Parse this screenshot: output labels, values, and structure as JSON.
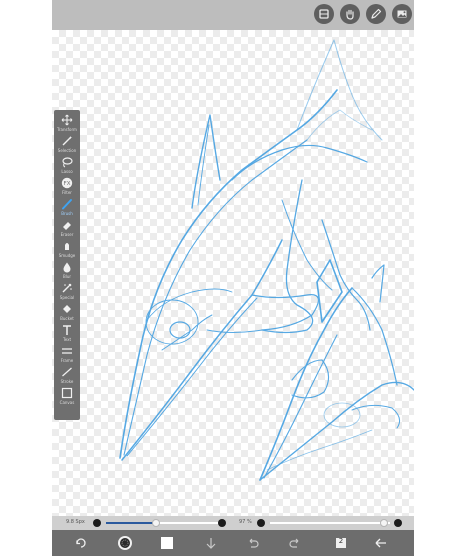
{
  "toolbar": {
    "items": [
      {
        "label": "Transform",
        "icon": "move-icon"
      },
      {
        "label": "Selection",
        "icon": "magic-wand-icon"
      },
      {
        "label": "Lasso",
        "icon": "lasso-icon"
      },
      {
        "label": "Filter",
        "icon": "fx-icon"
      },
      {
        "label": "Brush",
        "icon": "brush-icon"
      },
      {
        "label": "Eraser",
        "icon": "eraser-icon"
      },
      {
        "label": "Smudge",
        "icon": "smudge-icon"
      },
      {
        "label": "Blur",
        "icon": "droplet-icon"
      },
      {
        "label": "Special",
        "icon": "special-icon"
      },
      {
        "label": "Bucket",
        "icon": "bucket-icon"
      },
      {
        "label": "Text",
        "icon": "text-icon"
      },
      {
        "label": "Frame",
        "icon": "frame-icon"
      },
      {
        "label": "Stroke",
        "icon": "stroke-icon"
      },
      {
        "label": "Canvas",
        "icon": "canvas-icon"
      }
    ],
    "selected": "Brush"
  },
  "sliders": {
    "size": {
      "label": "9.8 Spx",
      "value": 0.45
    },
    "opacity": {
      "label": "97 %",
      "value": 0.95
    }
  },
  "topbar": {
    "icons": [
      "layers-icon",
      "hand-icon",
      "pen-icon",
      "gallery-icon"
    ]
  },
  "bottombar": {
    "icons": [
      "rotate-icon",
      "brush-palette-icon",
      "color-swatch-icon",
      "download-icon",
      "undo-icon",
      "redo-icon",
      "layer-count-icon",
      "back-arrow-icon"
    ],
    "layer_count": "2"
  },
  "colors": {
    "sketch": "#3a9be0",
    "toolbar_bg": "#6f6f6f",
    "bottombar_bg": "#6d6d6d",
    "topbar_bg": "#bdbdbd",
    "slider_fill": "#2b5a9e"
  }
}
